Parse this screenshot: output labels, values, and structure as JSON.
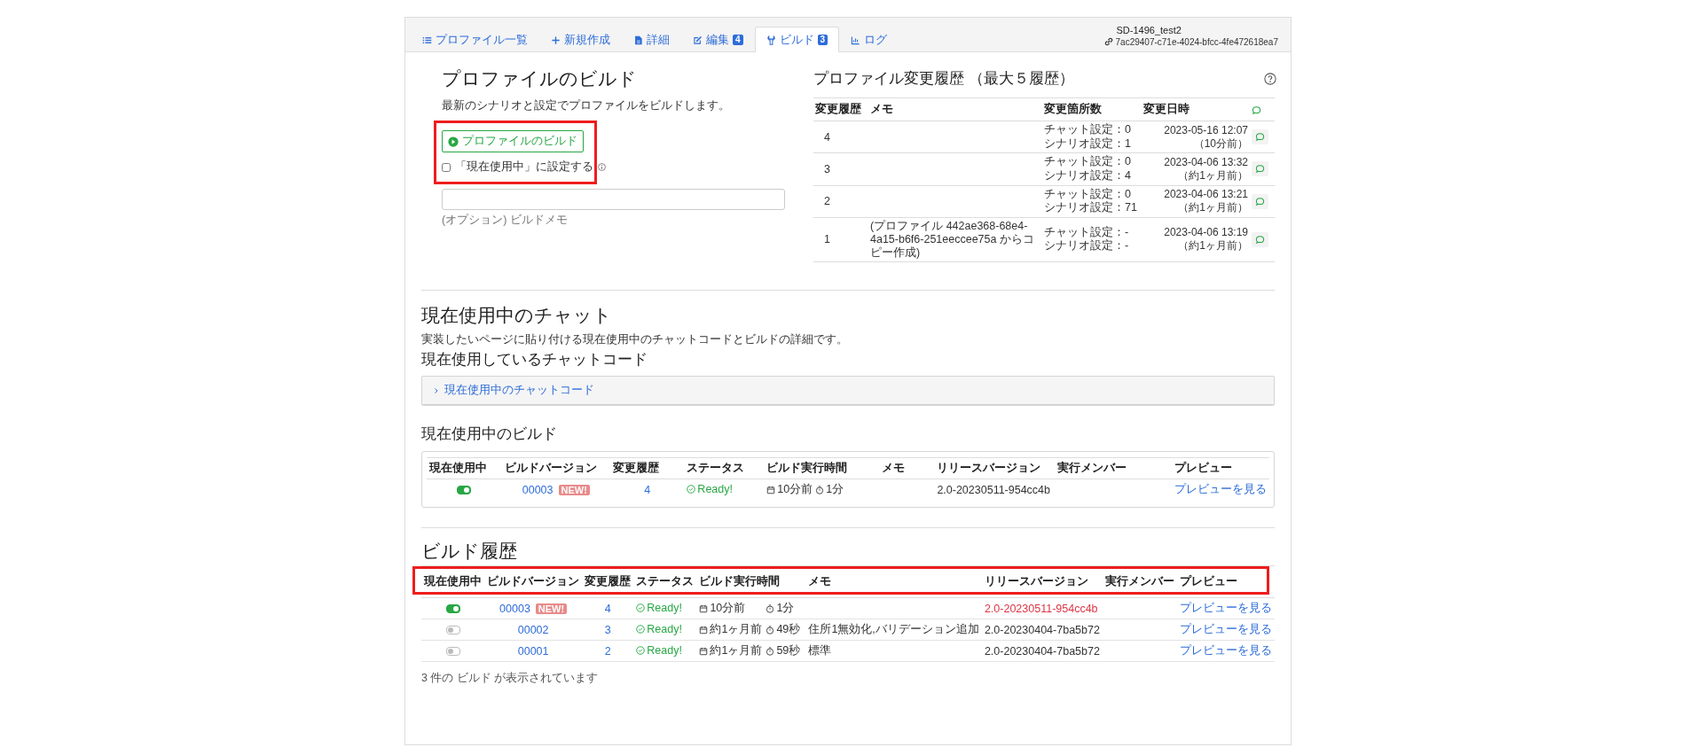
{
  "tabs": [
    {
      "label": "プロファイル一覧",
      "selected": false
    },
    {
      "label": "新規作成",
      "selected": false
    },
    {
      "label": "詳細",
      "selected": false
    },
    {
      "label": "編集",
      "badge": "4",
      "selected": false
    },
    {
      "label": "ビルド",
      "badge": "3",
      "selected": true
    },
    {
      "label": "ログ",
      "selected": false
    }
  ],
  "profile": {
    "name": "SD-1496_test2",
    "id": "7ac29407-c71e-4024-bfcc-4fe472618ea7"
  },
  "build_form": {
    "title": "プロファイルのビルド",
    "description": "最新のシナリオと設定でプロファイルをビルドします。",
    "highlighted": true,
    "button": "プロファイルのビルド",
    "set_current": {
      "label": "「現在使用中」に設定する",
      "checked": false
    },
    "memo_hint": "(オプション) ビルドメモ"
  },
  "change_history": {
    "title": "プロファイル変更履歴 （最大５履歴）",
    "columns": [
      "変更履歴",
      "メモ",
      "変更箇所数",
      "変更日時"
    ],
    "rows": [
      {
        "revision": "4",
        "changes": [
          "チャット設定：0",
          "シナリオ設定：1"
        ],
        "date": "2023-05-16 12:07",
        "ago": "（10分前）"
      },
      {
        "revision": "3",
        "changes": [
          "チャット設定：0",
          "シナリオ設定：4"
        ],
        "date": "2023-04-06 13:32",
        "ago": "（約1ヶ月前）"
      },
      {
        "revision": "2",
        "changes": [
          "チャット設定：0",
          "シナリオ設定：71"
        ],
        "date": "2023-04-06 13:21",
        "ago": "（約1ヶ月前）"
      },
      {
        "revision": "1",
        "memo": "(プロファイル 442ae368-68e4-4a15-b6f6-251eeccee75a からコピー作成)",
        "changes": [
          "チャット設定：-",
          "シナリオ設定：-"
        ],
        "date": "2023-04-06 13:19",
        "ago": "（約1ヶ月前）"
      }
    ]
  },
  "current_chat": {
    "title": "現在使用中のチャット",
    "description": "実装したいページに貼り付ける現在使用中のチャットコードとビルドの詳細です。",
    "code_title": "現在使用しているチャットコード",
    "code_toggle": {
      "label": "現在使用中のチャットコード",
      "expanded": false
    }
  },
  "current_build": {
    "title": "現在使用中のビルド",
    "columns": [
      "現在使用中",
      "ビルドバージョン",
      "変更履歴",
      "ステータス",
      "ビルド実行時間",
      "メモ",
      "リリースバージョン",
      "実行メンバー",
      "プレビュー"
    ],
    "rows": [
      {
        "in_use": true,
        "version": "00003",
        "badge": "NEW!",
        "revision": "4",
        "status": "Ready!",
        "date": "10分前",
        "duration": "1分",
        "release": "2.0-20230511-954cc4b",
        "release_alert": false,
        "preview": "プレビューを見る"
      }
    ]
  },
  "build_history": {
    "title": "ビルド履歴",
    "header_highlighted": true,
    "columns": [
      "現在使用中",
      "ビルドバージョン",
      "変更履歴",
      "ステータス",
      "ビルド実行時間",
      "メモ",
      "リリースバージョン",
      "実行メンバー",
      "プレビュー"
    ],
    "rows": [
      {
        "in_use": true,
        "version": "00003",
        "badge": "NEW!",
        "revision": "4",
        "status": "Ready!",
        "date": "10分前",
        "duration": "1分",
        "release": "2.0-20230511-954cc4b",
        "release_alert": true,
        "preview": "プレビューを見る"
      },
      {
        "in_use": false,
        "version": "00002",
        "revision": "3",
        "status": "Ready!",
        "date": "約1ヶ月前",
        "duration": "49秒",
        "memo": "住所1無効化,バリデーション追加",
        "release": "2.0-20230404-7ba5b72",
        "release_alert": false,
        "preview": "プレビューを見る"
      },
      {
        "in_use": false,
        "version": "00001",
        "revision": "2",
        "status": "Ready!",
        "date": "約1ヶ月前",
        "duration": "59秒",
        "memo": "標準",
        "release": "2.0-20230404-7ba5b72",
        "release_alert": false,
        "preview": "プレビューを見る"
      }
    ],
    "footer": "3 件の ビルド が表示されています"
  }
}
